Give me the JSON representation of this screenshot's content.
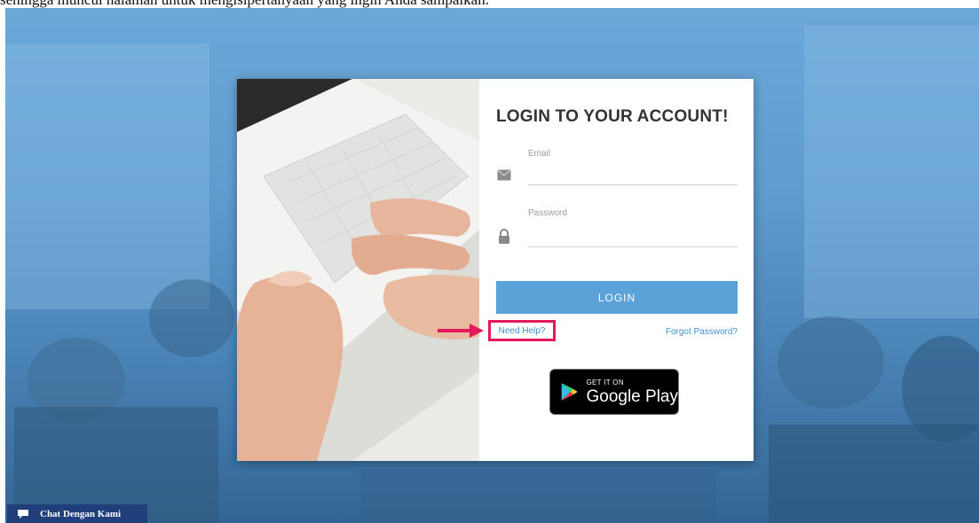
{
  "caption": "sehingga muncul halaman untuk mengisipertanyaan yang ingin Anda sampaikan.",
  "login": {
    "title": "LOGIN TO YOUR ACCOUNT!",
    "email_label": "Email",
    "email_value": "",
    "password_label": "Password",
    "password_value": "",
    "login_button": "LOGIN",
    "need_help": "Need Help?",
    "forgot_password": "Forgot Password?"
  },
  "play_badge": {
    "small_text": "GET IT ON",
    "big_text": "Google Play"
  },
  "chat": {
    "label": "Chat Dengan Kami"
  },
  "icons": {
    "email": "envelope-icon",
    "password": "lock-icon",
    "chat": "chat-bubble-icon",
    "play": "google-play-icon",
    "annotation": "arrow-icon"
  },
  "colors": {
    "primary": "#5aa2d8",
    "highlight": "#e2195b",
    "chat_bg": "#1f3e7a",
    "link": "#3f8fcf"
  }
}
